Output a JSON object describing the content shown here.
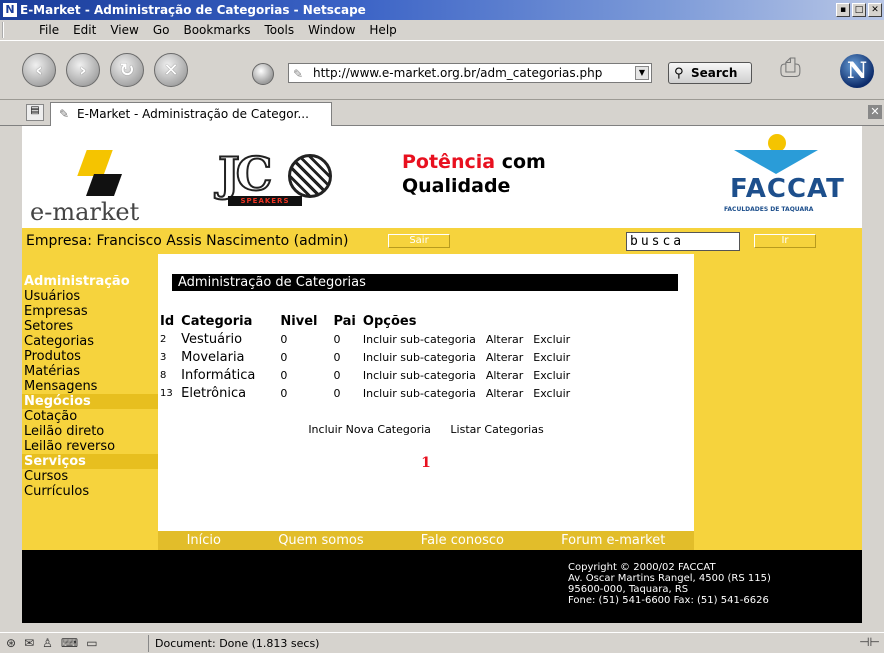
{
  "window": {
    "title": "E-Market - Administração de Categorias - Netscape",
    "app_icon": "N"
  },
  "menubar": {
    "items": [
      "File",
      "Edit",
      "View",
      "Go",
      "Bookmarks",
      "Tools",
      "Window",
      "Help"
    ]
  },
  "navigation": {
    "url": "http://www.e-market.org.br/adm_categorias.php",
    "search_label": "Search",
    "icons": [
      "back-icon",
      "forward-icon",
      "reload-icon",
      "stop-icon",
      "home-icon",
      "print-icon",
      "netscape-logo-icon"
    ]
  },
  "tab": {
    "label": "E-Market - Administração de Categor..."
  },
  "header": {
    "logo_text": "e-market",
    "jc_letters": "JC",
    "jc_sub": "SPEAKERS",
    "slogan_red": "Potência",
    "slogan_rest_1": " com",
    "slogan_rest_2": "Qualidade",
    "faccat_name": "FACCAT",
    "faccat_sub": "FACULDADES DE TAQUARA"
  },
  "infobar": {
    "company": "Empresa: Francisco Assis Nascimento (admin)",
    "logout_label": "Sair",
    "search_value": "busca",
    "go_label": "Ir"
  },
  "sidebar": {
    "admin_heading": "Administração",
    "admin_items": [
      "Usuários",
      "Empresas",
      "Setores",
      "Categorias",
      "Produtos",
      "Matérias",
      "Mensagens"
    ],
    "business_heading": "Negócios",
    "business_items": [
      "Cotação",
      "Leilão direto",
      "Leilão reverso"
    ],
    "services_heading": "Serviços",
    "services_items": [
      "Cursos",
      "Currículos"
    ]
  },
  "content": {
    "title": "Administração de Categorias",
    "columns": [
      "Id",
      "Categoria",
      "Nivel",
      "Pai",
      "Opções"
    ],
    "rows": [
      {
        "id": "2",
        "categoria": "Vestuário",
        "nivel": "0",
        "pai": "0"
      },
      {
        "id": "3",
        "categoria": "Movelaria",
        "nivel": "0",
        "pai": "0"
      },
      {
        "id": "8",
        "categoria": "Informática",
        "nivel": "0",
        "pai": "0"
      },
      {
        "id": "13",
        "categoria": "Eletrônica",
        "nivel": "0",
        "pai": "0"
      }
    ],
    "option_include": "Incluir sub-categoria",
    "option_edit": "Alterar",
    "option_delete": "Excluir",
    "link_new": "Incluir Nova Categoria",
    "link_list": "Listar Categorias",
    "page": "1"
  },
  "footer": {
    "nav": [
      "Início",
      "Quem somos",
      "Fale conosco",
      "Forum e-market"
    ],
    "copyright_lines": [
      "Copyright © 2000/02 FACCAT",
      "Av. Oscar Martins Rangel, 4500 (RS 115)",
      "95600-000, Taquara, RS",
      "Fone: (51) 541-6600 Fax: (51) 541-6626"
    ]
  },
  "status": {
    "text": "Document: Done (1.813 secs)"
  }
}
